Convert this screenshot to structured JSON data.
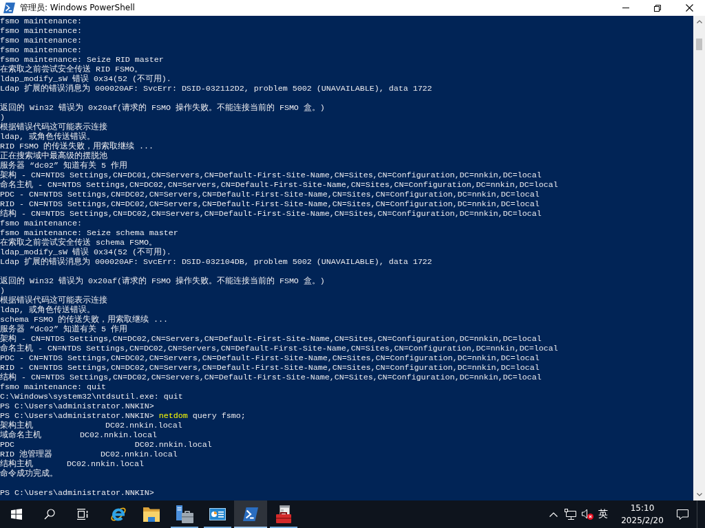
{
  "window": {
    "title": "管理员: Windows PowerShell"
  },
  "console": {
    "lines": [
      {
        "kind": "text",
        "text": "fsmo maintenance:"
      },
      {
        "kind": "text",
        "text": "fsmo maintenance:"
      },
      {
        "kind": "text",
        "text": "fsmo maintenance:"
      },
      {
        "kind": "text",
        "text": "fsmo maintenance:"
      },
      {
        "kind": "text",
        "text": "fsmo maintenance: Seize RID master"
      },
      {
        "kind": "text",
        "text": "在索取之前尝试安全传送 RID FSMO。"
      },
      {
        "kind": "text",
        "text": "ldap_modify_sW 错误 0x34(52 (不可用)."
      },
      {
        "kind": "text",
        "text": "Ldap 扩展的错误消息为 000020AF: SvcErr: DSID-032112D2, problem 5002 (UNAVAILABLE), data 1722"
      },
      {
        "kind": "blank"
      },
      {
        "kind": "text",
        "text": "返回的 Win32 错误为 0x20af(请求的 FSMO 操作失败。不能连接当前的 FSMO 盒。)"
      },
      {
        "kind": "text",
        "text": ")"
      },
      {
        "kind": "text",
        "text": "根据错误代码这可能表示连接"
      },
      {
        "kind": "text",
        "text": "ldap, 或角色传送错误。"
      },
      {
        "kind": "text",
        "text": "RID FSMO 的传送失败，用索取继续 ..."
      },
      {
        "kind": "text",
        "text": "正在搜索域中最高级的摆脱池"
      },
      {
        "kind": "text",
        "text": "服务器 “dc02” 知道有关 5 作用"
      },
      {
        "kind": "text",
        "text": "架构 - CN=NTDS Settings,CN=DC01,CN=Servers,CN=Default-First-Site-Name,CN=Sites,CN=Configuration,DC=nnkin,DC=local"
      },
      {
        "kind": "text",
        "text": "命名主机 - CN=NTDS Settings,CN=DC02,CN=Servers,CN=Default-First-Site-Name,CN=Sites,CN=Configuration,DC=nnkin,DC=local"
      },
      {
        "kind": "text",
        "text": "PDC - CN=NTDS Settings,CN=DC02,CN=Servers,CN=Default-First-Site-Name,CN=Sites,CN=Configuration,DC=nnkin,DC=local"
      },
      {
        "kind": "text",
        "text": "RID - CN=NTDS Settings,CN=DC02,CN=Servers,CN=Default-First-Site-Name,CN=Sites,CN=Configuration,DC=nnkin,DC=local"
      },
      {
        "kind": "text",
        "text": "结构 - CN=NTDS Settings,CN=DC02,CN=Servers,CN=Default-First-Site-Name,CN=Sites,CN=Configuration,DC=nnkin,DC=local"
      },
      {
        "kind": "text",
        "text": "fsmo maintenance:"
      },
      {
        "kind": "text",
        "text": "fsmo maintenance: Seize schema master"
      },
      {
        "kind": "text",
        "text": "在索取之前尝试安全传送 schema FSMO。"
      },
      {
        "kind": "text",
        "text": "ldap_modify_sW 错误 0x34(52 (不可用)."
      },
      {
        "kind": "text",
        "text": "Ldap 扩展的错误消息为 000020AF: SvcErr: DSID-032104DB, problem 5002 (UNAVAILABLE), data 1722"
      },
      {
        "kind": "blank"
      },
      {
        "kind": "text",
        "text": "返回的 Win32 错误为 0x20af(请求的 FSMO 操作失败。不能连接当前的 FSMO 盒。)"
      },
      {
        "kind": "text",
        "text": ")"
      },
      {
        "kind": "text",
        "text": "根据错误代码这可能表示连接"
      },
      {
        "kind": "text",
        "text": "ldap, 或角色传送错误。"
      },
      {
        "kind": "text",
        "text": "schema FSMO 的传送失败，用索取继续 ..."
      },
      {
        "kind": "text",
        "text": "服务器 “dc02” 知道有关 5 作用"
      },
      {
        "kind": "text",
        "text": "架构 - CN=NTDS Settings,CN=DC02,CN=Servers,CN=Default-First-Site-Name,CN=Sites,CN=Configuration,DC=nnkin,DC=local"
      },
      {
        "kind": "text",
        "text": "命名主机 - CN=NTDS Settings,CN=DC02,CN=Servers,CN=Default-First-Site-Name,CN=Sites,CN=Configuration,DC=nnkin,DC=local"
      },
      {
        "kind": "text",
        "text": "PDC - CN=NTDS Settings,CN=DC02,CN=Servers,CN=Default-First-Site-Name,CN=Sites,CN=Configuration,DC=nnkin,DC=local"
      },
      {
        "kind": "text",
        "text": "RID - CN=NTDS Settings,CN=DC02,CN=Servers,CN=Default-First-Site-Name,CN=Sites,CN=Configuration,DC=nnkin,DC=local"
      },
      {
        "kind": "text",
        "text": "结构 - CN=NTDS Settings,CN=DC02,CN=Servers,CN=Default-First-Site-Name,CN=Sites,CN=Configuration,DC=nnkin,DC=local"
      },
      {
        "kind": "text",
        "text": "fsmo maintenance: quit"
      },
      {
        "kind": "text",
        "text": "C:\\Windows\\system32\\ntdsutil.exe: quit"
      },
      {
        "kind": "text",
        "text": "PS C:\\Users\\administrator.NNKIN>"
      },
      {
        "kind": "command",
        "prompt": "PS C:\\Users\\administrator.NNKIN>",
        "command": "netdom",
        "args": "query fsmo;"
      },
      {
        "kind": "text",
        "text": "架构主机               DC02.nnkin.local"
      },
      {
        "kind": "text",
        "text": "域命名主机        DC02.nnkin.local"
      },
      {
        "kind": "text",
        "text": "PDC                         DC02.nnkin.local"
      },
      {
        "kind": "text",
        "text": "RID 池管理器          DC02.nnkin.local"
      },
      {
        "kind": "text",
        "text": "结构主机       DC02.nnkin.local"
      },
      {
        "kind": "text",
        "text": "命令成功完成。"
      },
      {
        "kind": "blank"
      },
      {
        "kind": "text",
        "text": "PS C:\\Users\\administrator.NNKIN>"
      }
    ]
  },
  "taskbar": {
    "apps": [
      {
        "kind": "browser",
        "running": false,
        "selected": false
      },
      {
        "kind": "folder",
        "running": false,
        "selected": false
      },
      {
        "kind": "server",
        "running": true,
        "selected": false
      },
      {
        "kind": "dashboard",
        "running": true,
        "selected": false
      },
      {
        "kind": "terminal",
        "running": true,
        "selected": true
      },
      {
        "kind": "toolbox",
        "running": true,
        "selected": false
      }
    ],
    "tray": {
      "language": "英",
      "time": "15:10",
      "date": "2025/2/20"
    }
  }
}
